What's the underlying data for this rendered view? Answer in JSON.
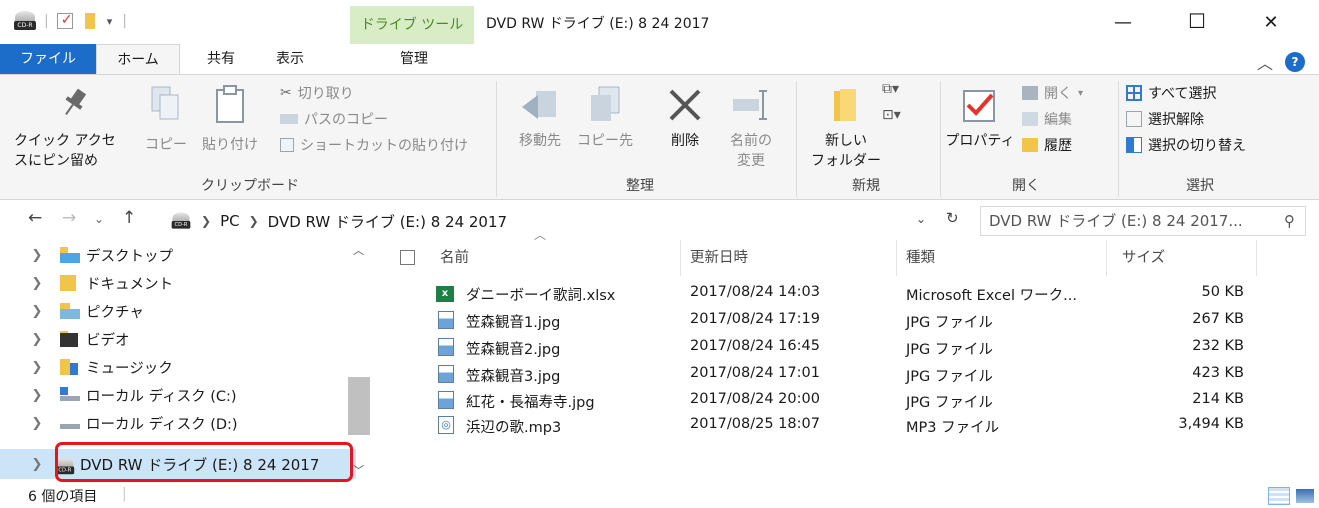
{
  "title_bar": {
    "context_tab": "ドライブ ツール",
    "window_title": "DVD RW ドライブ (E:) 8 24 2017",
    "minimize": "—",
    "maximize": "☐",
    "close": "✕",
    "drive_badge": "CD-R"
  },
  "tabs": {
    "file": "ファイル",
    "home": "ホーム",
    "share": "共有",
    "view": "表示",
    "manage": "管理",
    "collapse": "︿",
    "help": "?"
  },
  "ribbon": {
    "clipboard": {
      "pin": "クイック アクセ\nスにピン留め",
      "copy": "コピー",
      "paste": "貼り付け",
      "cut": "切り取り",
      "copy_path": "パスのコピー",
      "paste_shortcut": "ショートカットの貼り付け",
      "label": "クリップボード"
    },
    "organize": {
      "move_to": "移動先",
      "copy_to": "コピー先",
      "delete": "削除",
      "rename": "名前の\n変更",
      "label": "整理"
    },
    "new": {
      "new_folder": "新しい\nフォルダー",
      "label": "新規"
    },
    "open": {
      "properties": "プロパティ",
      "open": "開く",
      "edit": "編集",
      "history": "履歴",
      "label": "開く"
    },
    "select": {
      "select_all": "すべて選択",
      "select_none": "選択解除",
      "invert": "選択の切り替え",
      "label": "選択"
    }
  },
  "address": {
    "crumbs": [
      "PC",
      "DVD RW ドライブ (E:) 8 24 2017"
    ],
    "search_placeholder": "DVD RW ドライブ (E:) 8 24 2017..."
  },
  "nav_pane": {
    "items": [
      {
        "label": "デスクトップ",
        "icon": "desktop-icon"
      },
      {
        "label": "ドキュメント",
        "icon": "documents-icon"
      },
      {
        "label": "ピクチャ",
        "icon": "pictures-icon"
      },
      {
        "label": "ビデオ",
        "icon": "videos-icon"
      },
      {
        "label": "ミュージック",
        "icon": "music-icon"
      },
      {
        "label": "ローカル ディスク (C:)",
        "icon": "local-disk-icon"
      },
      {
        "label": "ローカル ディスク (D:)",
        "icon": "local-disk-icon"
      },
      {
        "label": "DVD RW ドライブ (E:) 8 24 2017",
        "icon": "dvd-drive-icon"
      }
    ]
  },
  "file_list": {
    "columns": {
      "name": "名前",
      "modified": "更新日時",
      "type": "種類",
      "size": "サイズ"
    },
    "rows": [
      {
        "name": "ダニーボーイ歌詞.xlsx",
        "modified": "2017/08/24 14:03",
        "type": "Microsoft Excel ワーク...",
        "size": "50 KB",
        "icon": "excel-file-icon"
      },
      {
        "name": "笠森観音1.jpg",
        "modified": "2017/08/24 17:19",
        "type": "JPG ファイル",
        "size": "267 KB",
        "icon": "image-file-icon"
      },
      {
        "name": "笠森観音2.jpg",
        "modified": "2017/08/24 16:45",
        "type": "JPG ファイル",
        "size": "232 KB",
        "icon": "image-file-icon"
      },
      {
        "name": "笠森観音3.jpg",
        "modified": "2017/08/24 17:01",
        "type": "JPG ファイル",
        "size": "423 KB",
        "icon": "image-file-icon"
      },
      {
        "name": "紅花・長福寿寺.jpg",
        "modified": "2017/08/24 20:00",
        "type": "JPG ファイル",
        "size": "214 KB",
        "icon": "image-file-icon"
      },
      {
        "name": "浜辺の歌.mp3",
        "modified": "2017/08/25 18:07",
        "type": "MP3 ファイル",
        "size": "3,494 KB",
        "icon": "audio-file-icon"
      }
    ]
  },
  "status": {
    "item_count": "6 個の項目"
  },
  "colors": {
    "accent": "#1c6dc9",
    "context_tab_bg": "#d8edc6",
    "context_tab_text": "#4c8a26",
    "selected_bg": "#cce4f7",
    "highlight_border": "#e8141c"
  }
}
